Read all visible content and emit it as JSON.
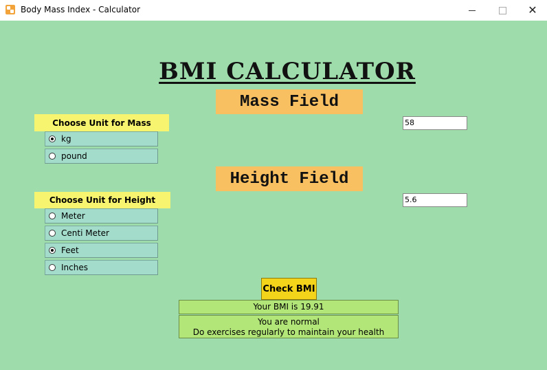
{
  "window": {
    "title": "Body Mass Index - Calculator",
    "minimize_icon": "minimize-icon",
    "maximize_icon": "maximize-icon",
    "close_icon": "close-icon"
  },
  "heading": "BMI CALCULATOR",
  "mass": {
    "label": "Mass Field",
    "unit_header": "Choose Unit for Mass",
    "options": [
      {
        "label": "kg",
        "selected": true
      },
      {
        "label": "pound",
        "selected": false
      }
    ],
    "input_value": "58"
  },
  "height": {
    "label": "Height Field",
    "unit_header": "Choose Unit for Height",
    "options": [
      {
        "label": "Meter",
        "selected": false
      },
      {
        "label": "Centi Meter",
        "selected": false
      },
      {
        "label": "Feet",
        "selected": true
      },
      {
        "label": "Inches",
        "selected": false
      }
    ],
    "input_value": "5.6"
  },
  "check_button": "Check BMI",
  "result": {
    "bmi_text": "Your BMI is 19.91",
    "message_line1": "You are normal",
    "message_line2": "Do exercises regularly to maintain your health"
  },
  "colors": {
    "background": "#9edcab",
    "field_label": "#f8c060",
    "unit_header": "#f7f56f",
    "radio_row": "#a4dccb",
    "button": "#f3d41b",
    "result": "#b3e679"
  }
}
